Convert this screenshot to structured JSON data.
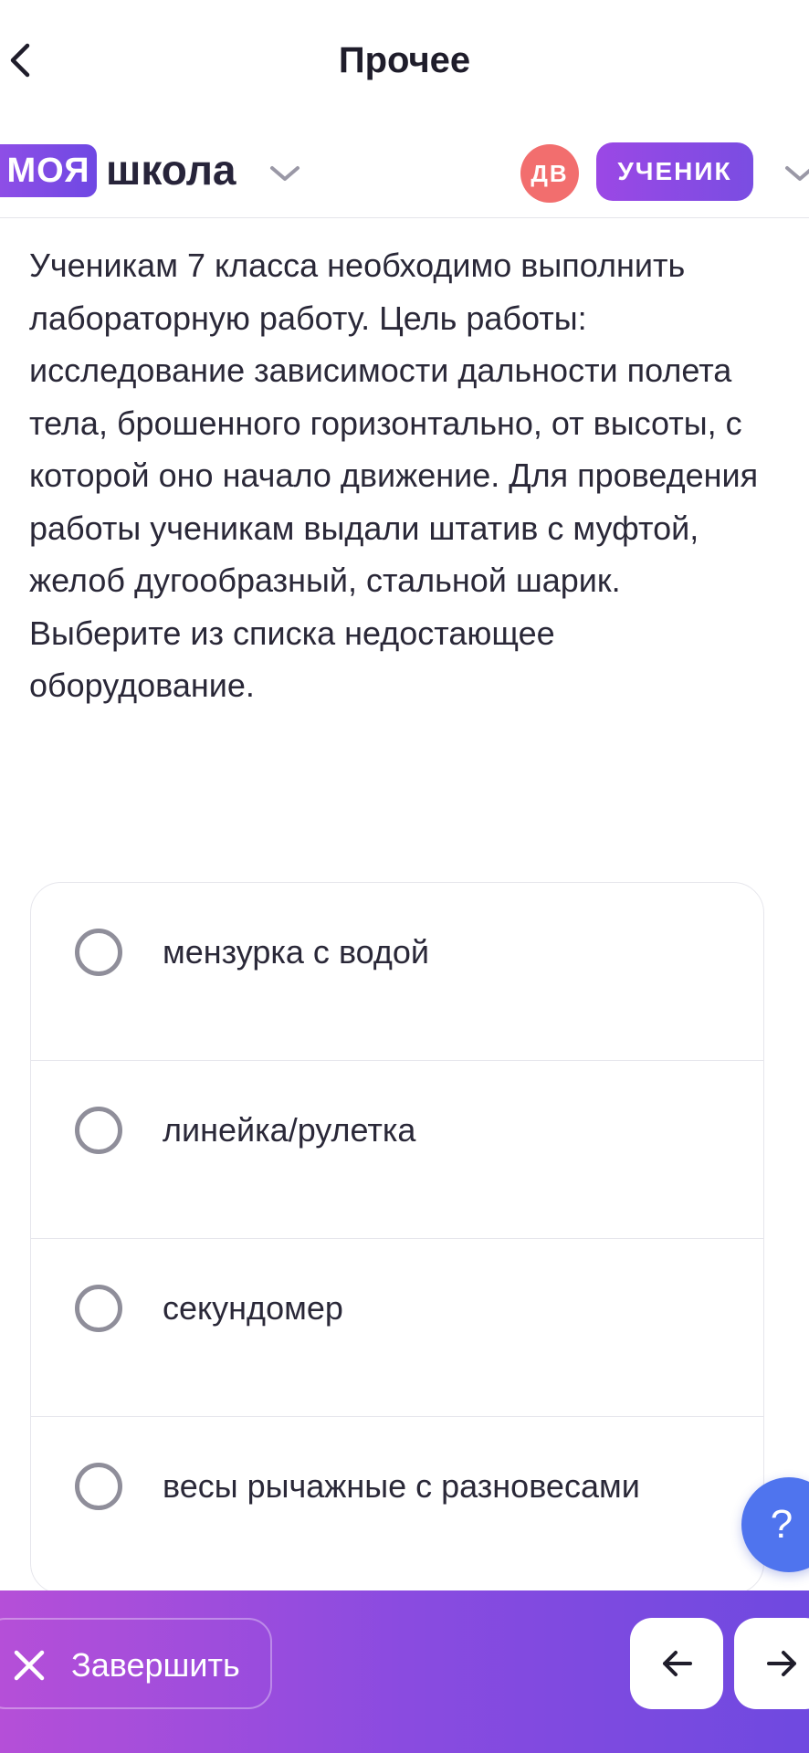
{
  "header": {
    "title": "Прочее"
  },
  "school": {
    "logo_badge": "МОЯ",
    "logo_word": "школа",
    "avatar_initials": "ДВ",
    "role": "УЧЕНИК"
  },
  "question": {
    "text": "Ученикам 7 класса необходимо выполнить лабораторную работу. Цель работы: исследование зависимости дальности полета тела, брошенного горизонтально, от высоты, с которой оно начало движение. Для проведения работы ученикам выдали штатив с муфтой, желоб дугообразный, стальной шарик. Выберите из списка недостающее оборудование."
  },
  "options": [
    {
      "label": "мензурка с водой"
    },
    {
      "label": "линейка/рулетка"
    },
    {
      "label": "секундомер"
    },
    {
      "label": "весы рычажные с разновесами"
    }
  ],
  "help": {
    "label": "?"
  },
  "footer": {
    "finish_label": "Завершить"
  },
  "colors": {
    "accent": "#7a4de2",
    "avatar": "#f26e6e",
    "help": "#4f74ee"
  }
}
